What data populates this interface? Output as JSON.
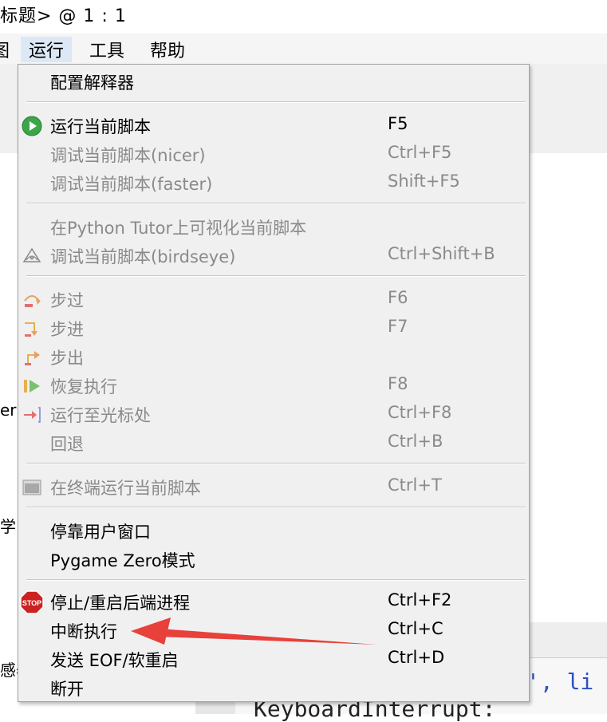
{
  "window": {
    "title_fragment": "标题>  @  1 : 1"
  },
  "menubar": {
    "items": [
      {
        "label": "图"
      },
      {
        "label": "运行"
      },
      {
        "label": "工具"
      },
      {
        "label": "帮助"
      }
    ]
  },
  "left_pane_fragments": [
    "er",
    "学",
    "感器"
  ],
  "shell": {
    "line1": "', li",
    "line2": "KeyboardInterrupt:"
  },
  "run_menu": {
    "items": [
      {
        "label": "配置解释器",
        "shortcut": "",
        "enabled": true
      },
      {
        "label": "运行当前脚本",
        "shortcut": "F5",
        "enabled": true,
        "icon": "run-icon"
      },
      {
        "label": "调试当前脚本(nicer)",
        "shortcut": "Ctrl+F5",
        "enabled": false
      },
      {
        "label": "调试当前脚本(faster)",
        "shortcut": "Shift+F5",
        "enabled": false
      },
      {
        "label": "在Python Tutor上可视化当前脚本",
        "shortcut": "",
        "enabled": false
      },
      {
        "label": "调试当前脚本(birdseye)",
        "shortcut": "Ctrl+Shift+B",
        "enabled": false,
        "icon": "birdseye-icon"
      },
      {
        "label": "步过",
        "shortcut": "F6",
        "enabled": false,
        "icon": "step-over-icon"
      },
      {
        "label": "步进",
        "shortcut": "F7",
        "enabled": false,
        "icon": "step-into-icon"
      },
      {
        "label": "步出",
        "shortcut": "",
        "enabled": false,
        "icon": "step-out-icon"
      },
      {
        "label": "恢复执行",
        "shortcut": "F8",
        "enabled": false,
        "icon": "resume-icon"
      },
      {
        "label": "运行至光标处",
        "shortcut": "Ctrl+F8",
        "enabled": false,
        "icon": "run-to-cursor-icon"
      },
      {
        "label": "回退",
        "shortcut": "Ctrl+B",
        "enabled": false
      },
      {
        "label": "在终端运行当前脚本",
        "shortcut": "Ctrl+T",
        "enabled": false,
        "icon": "terminal-icon"
      },
      {
        "label": "停靠用户窗口",
        "shortcut": "",
        "enabled": true
      },
      {
        "label": "Pygame Zero模式",
        "shortcut": "",
        "enabled": true
      },
      {
        "label": "停止/重启后端进程",
        "shortcut": "Ctrl+F2",
        "enabled": true,
        "icon": "stop-icon"
      },
      {
        "label": "中断执行",
        "shortcut": "Ctrl+C",
        "enabled": true
      },
      {
        "label": "发送 EOF/软重启",
        "shortcut": "Ctrl+D",
        "enabled": true
      },
      {
        "label": "断开",
        "shortcut": "",
        "enabled": true
      }
    ],
    "stop_icon_text": "STOP"
  },
  "colors": {
    "menu_bg": "#f0f0f0",
    "disabled_text": "#8a8a8a",
    "annotation_arrow": "#e8403a",
    "run_icon": "#3aa64a",
    "stop_icon": "#cc2222"
  }
}
